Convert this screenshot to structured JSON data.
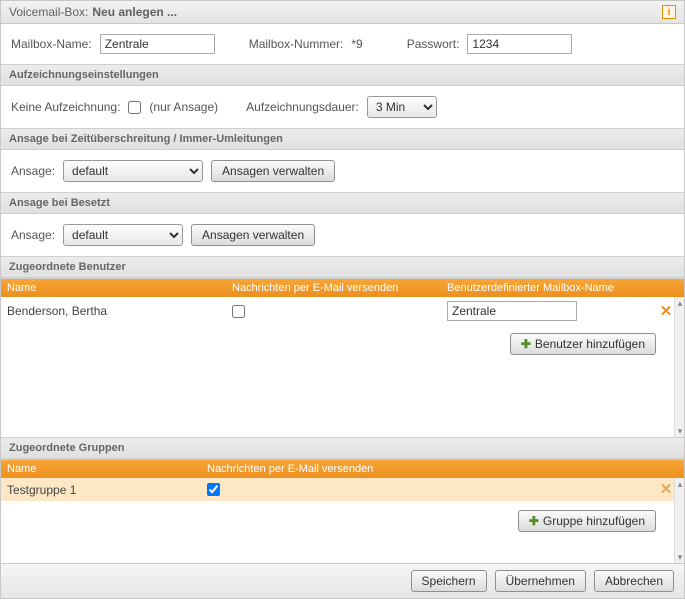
{
  "title": {
    "prefix": "Voicemail-Box:",
    "name": "Neu anlegen ..."
  },
  "info_icon_glyph": "i",
  "basic": {
    "name_label": "Mailbox-Name:",
    "name_value": "Zentrale",
    "number_label": "Mailbox-Nummer:",
    "number_value": "*9",
    "password_label": "Passwort:",
    "password_value": "1234"
  },
  "recording": {
    "section": "Aufzeichnungseinstellungen",
    "none_label": "Keine Aufzeichnung:",
    "none_checked": false,
    "none_hint": "(nur Ansage)",
    "duration_label": "Aufzeichnungsdauer:",
    "duration_value": "3 Min"
  },
  "ansage_timeout": {
    "section": "Ansage bei Zeitüberschreitung / Immer-Umleitungen",
    "label": "Ansage:",
    "value": "default",
    "manage_btn": "Ansagen verwalten"
  },
  "ansage_busy": {
    "section": "Ansage bei Besetzt",
    "label": "Ansage:",
    "value": "default",
    "manage_btn": "Ansagen verwalten"
  },
  "users": {
    "section": "Zugeordnete Benutzer",
    "hdr_name": "Name",
    "hdr_mail": "Nachrichten per E-Mail versenden",
    "hdr_mbx": "Benutzerdefinierter Mailbox-Name",
    "rows": [
      {
        "name": "Benderson, Bertha",
        "mail": false,
        "mbx": "Zentrale"
      }
    ],
    "add_btn": "Benutzer hinzufügen"
  },
  "groups": {
    "section": "Zugeordnete Gruppen",
    "hdr_name": "Name",
    "hdr_mail": "Nachrichten per E-Mail versenden",
    "rows": [
      {
        "name": "Testgruppe 1",
        "mail": true
      }
    ],
    "add_btn": "Gruppe hinzufügen"
  },
  "footer": {
    "save": "Speichern",
    "apply": "Übernehmen",
    "cancel": "Abbrechen"
  },
  "glyphs": {
    "delete": "✕",
    "plus": "✚",
    "up": "▴",
    "down": "▾"
  }
}
